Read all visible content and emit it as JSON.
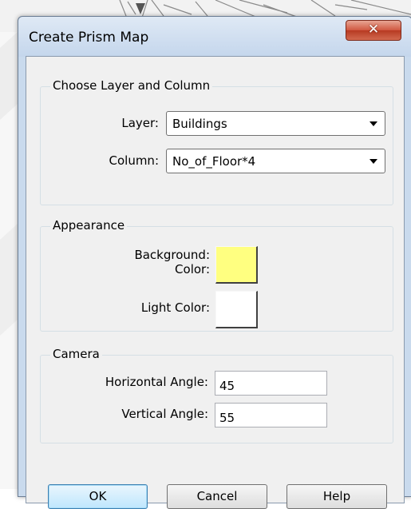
{
  "dialog": {
    "title": "Create Prism Map",
    "close_label": "✕"
  },
  "layer_group": {
    "legend": "Choose Layer and Column",
    "layer_label": "Layer:",
    "layer_value": "Buildings",
    "column_label": "Column:",
    "column_value": "No_of_Floor*4"
  },
  "appearance_group": {
    "legend": "Appearance",
    "background_label_line1": "Background:",
    "background_label_line2": "Color:",
    "background_color": "#ffff80",
    "light_label": "Light Color:",
    "light_color": "#ffffff"
  },
  "camera_group": {
    "legend": "Camera",
    "horizontal_label": "Horizontal Angle:",
    "horizontal_value": "45",
    "vertical_label": "Vertical Angle:",
    "vertical_value": "55"
  },
  "buttons": {
    "ok": "OK",
    "cancel": "Cancel",
    "help": "Help"
  }
}
